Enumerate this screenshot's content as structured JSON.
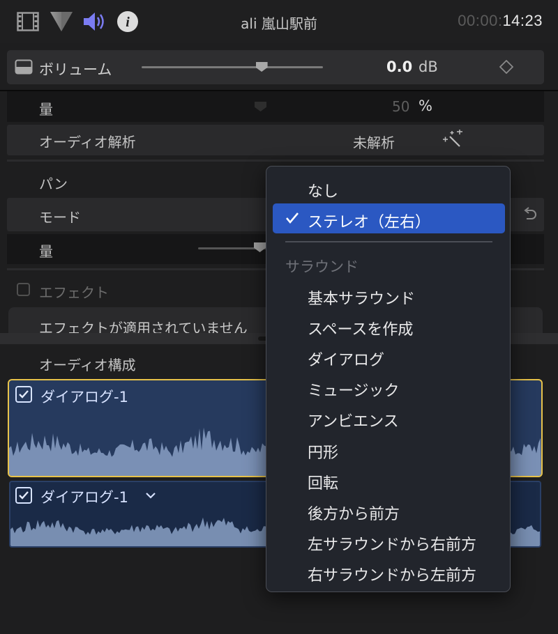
{
  "toolbar": {
    "icons": [
      "film-icon",
      "color-icon",
      "audio-icon",
      "info-icon"
    ],
    "clip_title": "ali 嵐山駅前",
    "timecode_dim": "00:00:",
    "timecode_bright": "14:23"
  },
  "volume": {
    "label": "ボリューム",
    "value": "0.0",
    "unit": "dB",
    "slider_level": 0.66
  },
  "rows": {
    "amount_label": "量",
    "amount_value": "50",
    "amount_unit": "%",
    "analysis_label": "オーディオ解析",
    "analysis_value": "未解析",
    "pan_label": "パン",
    "mode_label": "モード",
    "pan_amount_label": "量",
    "effects_label": "エフェクト",
    "effects_empty": "エフェクトが適用されていません"
  },
  "audio_config": {
    "label": "オーディオ構成",
    "lanes": [
      {
        "name": "ダイアログ-1",
        "checked": true
      },
      {
        "name": "ダイアログ-1",
        "checked": true
      }
    ]
  },
  "menu": {
    "items_top": [
      "なし",
      "ステレオ（左右）"
    ],
    "selected_index": 1,
    "header": "サラウンド",
    "items": [
      "基本サラウンド",
      "スペースを作成",
      "ダイアログ",
      "ミュージック",
      "アンビエンス",
      "円形",
      "回転",
      "後方から前方",
      "左サラウンドから右前方",
      "右サラウンドから左前方"
    ]
  },
  "colors": {
    "accent": "#2b58c2",
    "lane_selected_border": "#e8c34a",
    "lane_fill": "#263a5e",
    "waveform": "#8aa0c4"
  }
}
